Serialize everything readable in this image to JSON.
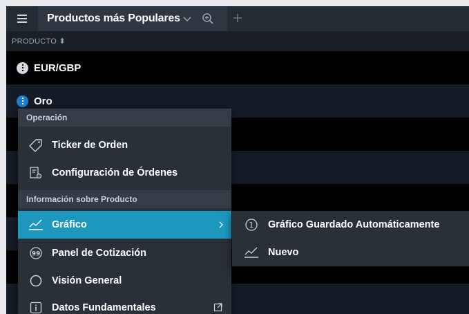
{
  "tab": {
    "title": "Productos más Populares",
    "icons": [
      "hamburger-menu-icon",
      "chevron-down-icon",
      "zoom-in-icon",
      "plus-icon"
    ]
  },
  "table": {
    "column_header": "PRODUCTO ⬍",
    "rows": [
      {
        "label": "EUR/GBP"
      },
      {
        "label": "Oro"
      }
    ]
  },
  "context_menu": {
    "sections": [
      {
        "title": "Operación"
      },
      {
        "title": "Información sobre Producto"
      }
    ],
    "items": [
      {
        "label": "Ticker de Orden",
        "icon": "tag-icon"
      },
      {
        "label": "Configuración de Órdenes",
        "icon": "order-settings-icon"
      },
      {
        "label": "Gráfico",
        "icon": "chart-line-icon",
        "has_submenu": true
      },
      {
        "label": "Panel de Cotización",
        "icon": "quote-icon"
      },
      {
        "label": "Visión General",
        "icon": "circle-icon"
      },
      {
        "label": "Datos Fundamentales",
        "icon": "info-box-icon",
        "external": true
      }
    ],
    "accent_color": "#1e97bf"
  },
  "submenu": {
    "items": [
      {
        "label": "Gráfico Guardado Automáticamente",
        "icon": "numbered-circle-icon",
        "icon_text": "1"
      },
      {
        "label": "Nuevo",
        "icon": "chart-line-icon"
      }
    ]
  }
}
